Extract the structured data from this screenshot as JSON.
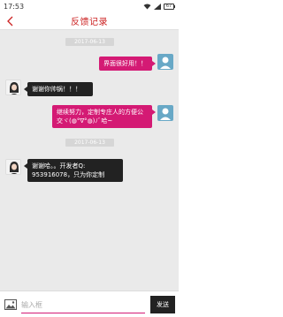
{
  "status_bar": {
    "time": "17:53",
    "battery": "67",
    "icons": [
      "wifi-icon",
      "signal-icon",
      "battery-icon"
    ]
  },
  "header": {
    "title": "反馈记录",
    "back_icon": "chevron-left-icon"
  },
  "messages": [
    {
      "type": "timestamp",
      "text": "2017-06-13"
    },
    {
      "type": "user",
      "text": "界面很好用！！"
    },
    {
      "type": "admin",
      "text": "谢谢你帅锅！！！"
    },
    {
      "type": "user",
      "text": "继续努力，定制专庄人的方便公交ヾ(◍°∇°◍)ﾉﾞ哈~"
    },
    {
      "type": "timestamp",
      "text": "2017-06-13"
    },
    {
      "type": "admin",
      "text": "谢谢哈。。开发者Q: 953916078，只为你定制"
    }
  ],
  "composer": {
    "placeholder": "输入框",
    "send_label": "发送",
    "image_icon": "image-icon"
  },
  "colors": {
    "accent": "#d41a74",
    "admin_bubble": "#222222",
    "chat_bg": "#eaeaea",
    "title": "#cc2222"
  }
}
